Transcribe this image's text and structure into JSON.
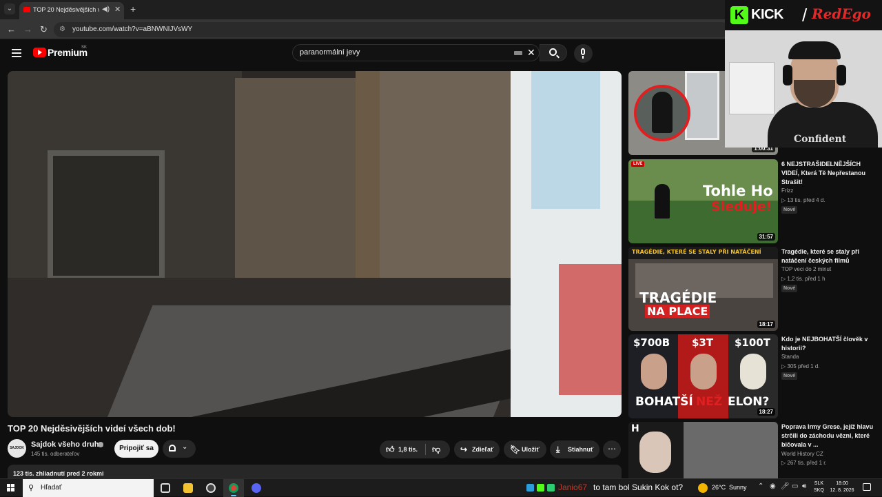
{
  "browser": {
    "tab_title": "TOP 20 Nejděsivějších videí",
    "url": "youtube.com/watch?v=aBNWNIJVsWY"
  },
  "yt": {
    "logo_text": "Premium",
    "region": "SK",
    "search_query": "paranormální jevy"
  },
  "video": {
    "title": "TOP 20 Nejděsivějších videí všech dob!",
    "channel_avatar_text": "SAJDOK",
    "channel": "Sajdok všeho druhu",
    "subscribers": "145 tis. odberateľov",
    "join_label": "Pripojiť sa",
    "likes": "1,8 tis.",
    "share_label": "Zdieľať",
    "save_label": "Uložiť",
    "download_label": "Stiahnuť",
    "more_label": "⋯",
    "meta": "123 tis. zhliadnutí  pred 2 rokmi"
  },
  "recommendations": [
    {
      "duration": "1:00:31",
      "title": "",
      "channel": "",
      "stats": "",
      "badge": ""
    },
    {
      "duration": "31:57",
      "live": "LIVE",
      "thumb_line1": "Tohle Ho",
      "thumb_line2": "Sleduje!",
      "title": "6 NEJSTRAŠIDELNĚJŠÍCH VIDEÍ, Která Tě Nepřestanou Strašit!",
      "channel": "Frizz",
      "stats": "▷ 13 tis.   před 4 d.",
      "badge": "Nové"
    },
    {
      "duration": "18:17",
      "thumb_banner": "TRAGÉDIE, KTERÉ SE STALY PŘI NATÁČENÍ",
      "thumb_line1": "TRAGÉDIE",
      "thumb_line2": "NA PLACE",
      "title": "Tragédie, které se staly při natáčení českých filmů",
      "channel": "TOP veci do 2 minut",
      "stats": "▷ 1,2 tis.   před 1 h",
      "badge": "Nové"
    },
    {
      "duration": "18:27",
      "thumb_vals": [
        "$700B",
        "$3T",
        "$100T"
      ],
      "thumb_line1": "BOHATŠÍ",
      "thumb_line2": "NEŽ",
      "thumb_line3": "ELON?",
      "title": "Kdo je NEJBOHATŠÍ člověk v historii?",
      "channel": "Standa",
      "stats": "▷ 305   před 1 d.",
      "badge": "Nové"
    },
    {
      "duration": "",
      "title": "Poprava Irmy Grese, jejíž hlavu strčili do záchodu vězni, které bičovala v ...",
      "channel": "World History CZ",
      "stats": "▷ 267 tis.   před 1 r.",
      "badge": ""
    }
  ],
  "overlay": {
    "kick_word": "KICK",
    "streamer": "RedEgo",
    "shirt_text": "Confident"
  },
  "taskbar": {
    "search_placeholder": "Hľadať",
    "chat_user": "Janio67",
    "chat_message": "to tam bol Sukin Kok ot?",
    "temperature": "26°C",
    "weather": "Sunny",
    "lang_top": "SLK",
    "lang_bottom": "SKQ",
    "time": "18:00",
    "date": "12. 8. 2026"
  },
  "colors": {
    "yt_red": "#ff0000",
    "kick_green": "#53fc18",
    "background": "#0f0f0f"
  }
}
